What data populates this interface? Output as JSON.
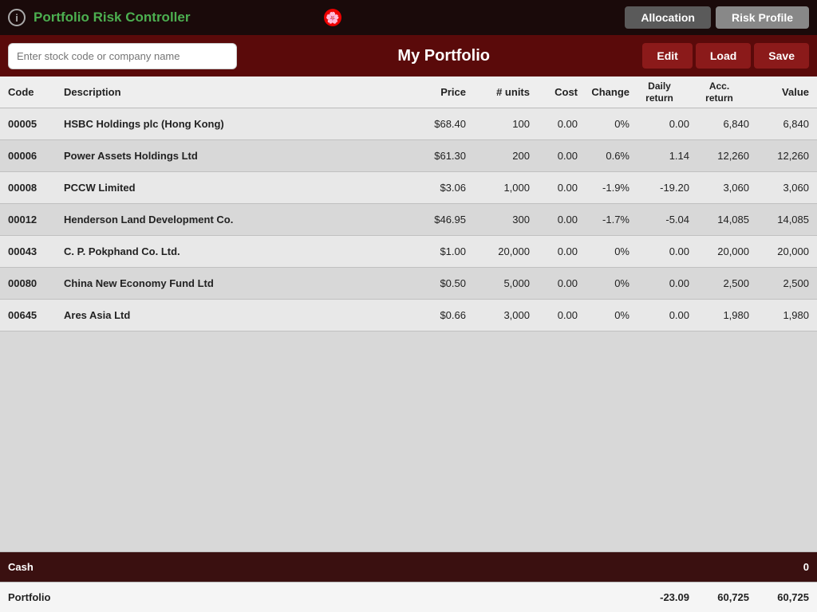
{
  "topbar": {
    "info_icon": "i",
    "title": "Portfolio Risk Controller",
    "flag_symbol": "🌸",
    "btn_allocation": "Allocation",
    "btn_risk_profile": "Risk Profile"
  },
  "header": {
    "search_placeholder": "Enter stock code or company name",
    "portfolio_title": "My Portfolio",
    "btn_edit": "Edit",
    "btn_load": "Load",
    "btn_save": "Save"
  },
  "columns": {
    "code": "Code",
    "description": "Description",
    "price": "Price",
    "units": "# units",
    "cost": "Cost",
    "change": "Change",
    "daily_return": "Daily return",
    "acc_return": "Acc. return",
    "value": "Value"
  },
  "rows": [
    {
      "code": "00005",
      "description": "HSBC Holdings plc (Hong Kong)",
      "price": "$68.40",
      "units": "100",
      "cost": "0.00",
      "change": "0%",
      "daily": "0.00",
      "acc": "6,840",
      "value": "6,840"
    },
    {
      "code": "00006",
      "description": "Power Assets Holdings Ltd",
      "price": "$61.30",
      "units": "200",
      "cost": "0.00",
      "change": "0.6%",
      "daily": "1.14",
      "acc": "12,260",
      "value": "12,260"
    },
    {
      "code": "00008",
      "description": "PCCW Limited",
      "price": "$3.06",
      "units": "1,000",
      "cost": "0.00",
      "change": "-1.9%",
      "daily": "-19.20",
      "acc": "3,060",
      "value": "3,060"
    },
    {
      "code": "00012",
      "description": "Henderson Land Development Co.",
      "price": "$46.95",
      "units": "300",
      "cost": "0.00",
      "change": "-1.7%",
      "daily": "-5.04",
      "acc": "14,085",
      "value": "14,085"
    },
    {
      "code": "00043",
      "description": "C. P. Pokphand Co. Ltd.",
      "price": "$1.00",
      "units": "20,000",
      "cost": "0.00",
      "change": "0%",
      "daily": "0.00",
      "acc": "20,000",
      "value": "20,000"
    },
    {
      "code": "00080",
      "description": "China New Economy Fund Ltd",
      "price": "$0.50",
      "units": "5,000",
      "cost": "0.00",
      "change": "0%",
      "daily": "0.00",
      "acc": "2,500",
      "value": "2,500"
    },
    {
      "code": "00645",
      "description": "Ares Asia Ltd",
      "price": "$0.66",
      "units": "3,000",
      "cost": "0.00",
      "change": "0%",
      "daily": "0.00",
      "acc": "1,980",
      "value": "1,980"
    }
  ],
  "footer": {
    "cash_label": "Cash",
    "cash_value": "0",
    "portfolio_label": "Portfolio",
    "portfolio_daily": "-23.09",
    "portfolio_acc": "60,725",
    "portfolio_value": "60,725"
  }
}
